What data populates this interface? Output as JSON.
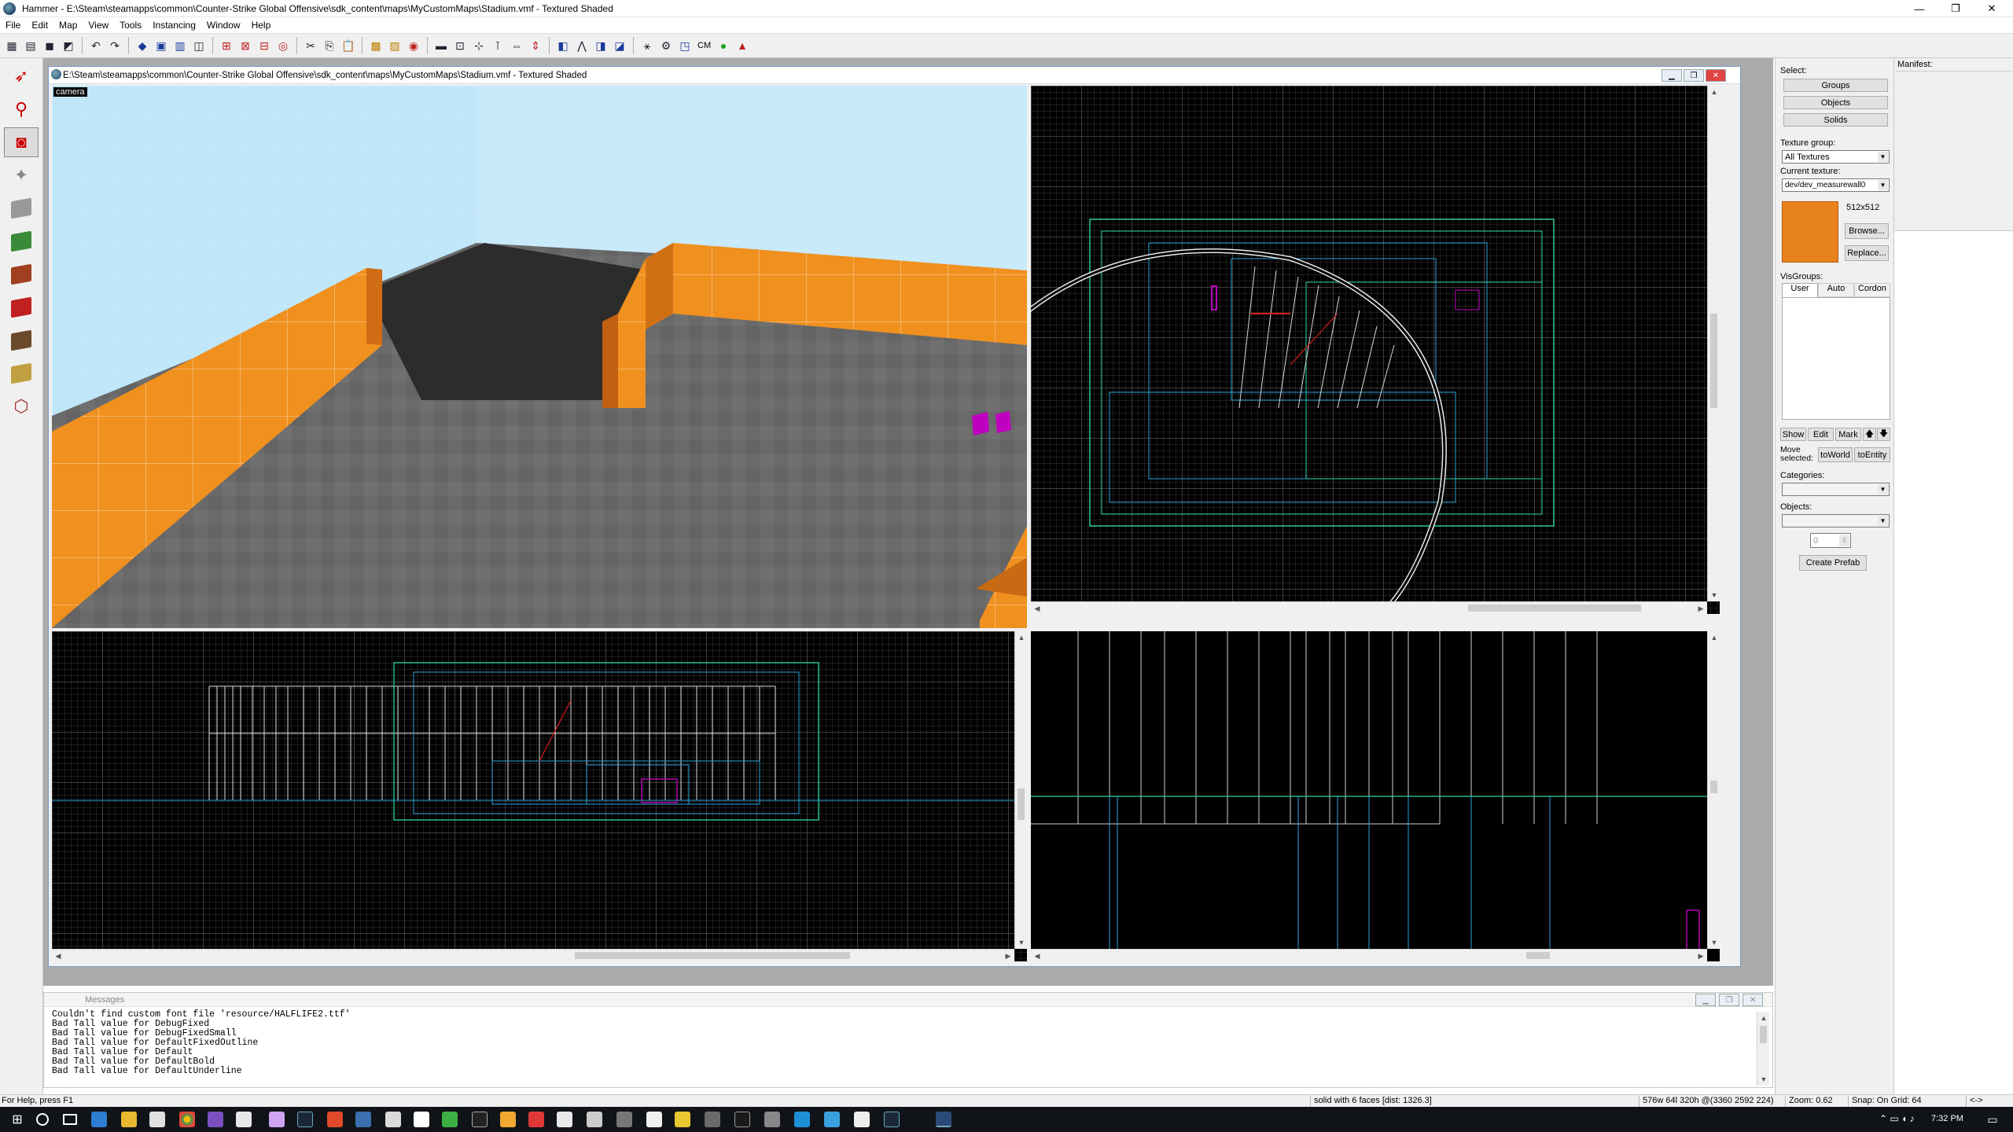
{
  "window": {
    "title": "Hammer - E:\\Steam\\steamapps\\common\\Counter-Strike Global Offensive\\sdk_content\\maps\\MyCustomMaps\\Stadium.vmf - Textured Shaded",
    "minimize": "—",
    "restore": "❐",
    "close": "✕"
  },
  "menu": [
    "File",
    "Edit",
    "Map",
    "View",
    "Tools",
    "Instancing",
    "Window",
    "Help"
  ],
  "toolbar": {
    "cm_label": "CM"
  },
  "document": {
    "title": "E:\\Steam\\steamapps\\common\\Counter-Strike Global Offensive\\sdk_content\\maps\\MyCustomMaps\\Stadium.vmf - Textured Shaded"
  },
  "viewport3d": {
    "label": "camera"
  },
  "rightpanel": {
    "select_label": "Select:",
    "groups": "Groups",
    "objects": "Objects",
    "solids": "Solids",
    "texture_group_label": "Texture group:",
    "texture_group_value": "All Textures",
    "current_texture_label": "Current texture:",
    "current_texture_value": "dev/dev_measurewall0",
    "texture_size": "512x512",
    "browse": "Browse...",
    "replace": "Replace...",
    "texture_color": "#e8821c",
    "visgroups_label": "VisGroups:",
    "tabs": [
      "User",
      "Auto",
      "Cordon"
    ],
    "show": "Show",
    "edit": "Edit",
    "mark": "Mark",
    "move_selected": "Move selected:",
    "to_world": "toWorld",
    "to_entity": "toEntity",
    "categories_label": "Categories:",
    "objects_label": "Objects:",
    "spinner_value": "0",
    "create_prefab": "Create Prefab"
  },
  "manifest": {
    "label": "Manifest:"
  },
  "messages": {
    "title": "Messages",
    "lines": [
      "Couldn't find custom font file 'resource/HALFLIFE2.ttf'",
      "Bad Tall value for DebugFixed",
      "Bad Tall value for DebugFixedSmall",
      "Bad Tall value for DefaultFixedOutline",
      "Bad Tall value for Default",
      "Bad Tall value for DefaultBold",
      "Bad Tall value for DefaultUnderline"
    ]
  },
  "statusbar": {
    "help": "For Help, press F1",
    "selection": "solid with 6 faces  [dist: 1326.3]",
    "size": "576w 64l 320h @(3360 2592 224)",
    "zoom": "Zoom: 0.62",
    "snap": "Snap: On Grid: 64",
    "arrows": "<->"
  },
  "taskbar": {
    "time": "7:32 PM"
  },
  "colors": {
    "orange_wall": "#f0901e",
    "sky": "#bde6f8",
    "floor": "#6a6a6a",
    "selection_purple": "#c000c0"
  }
}
